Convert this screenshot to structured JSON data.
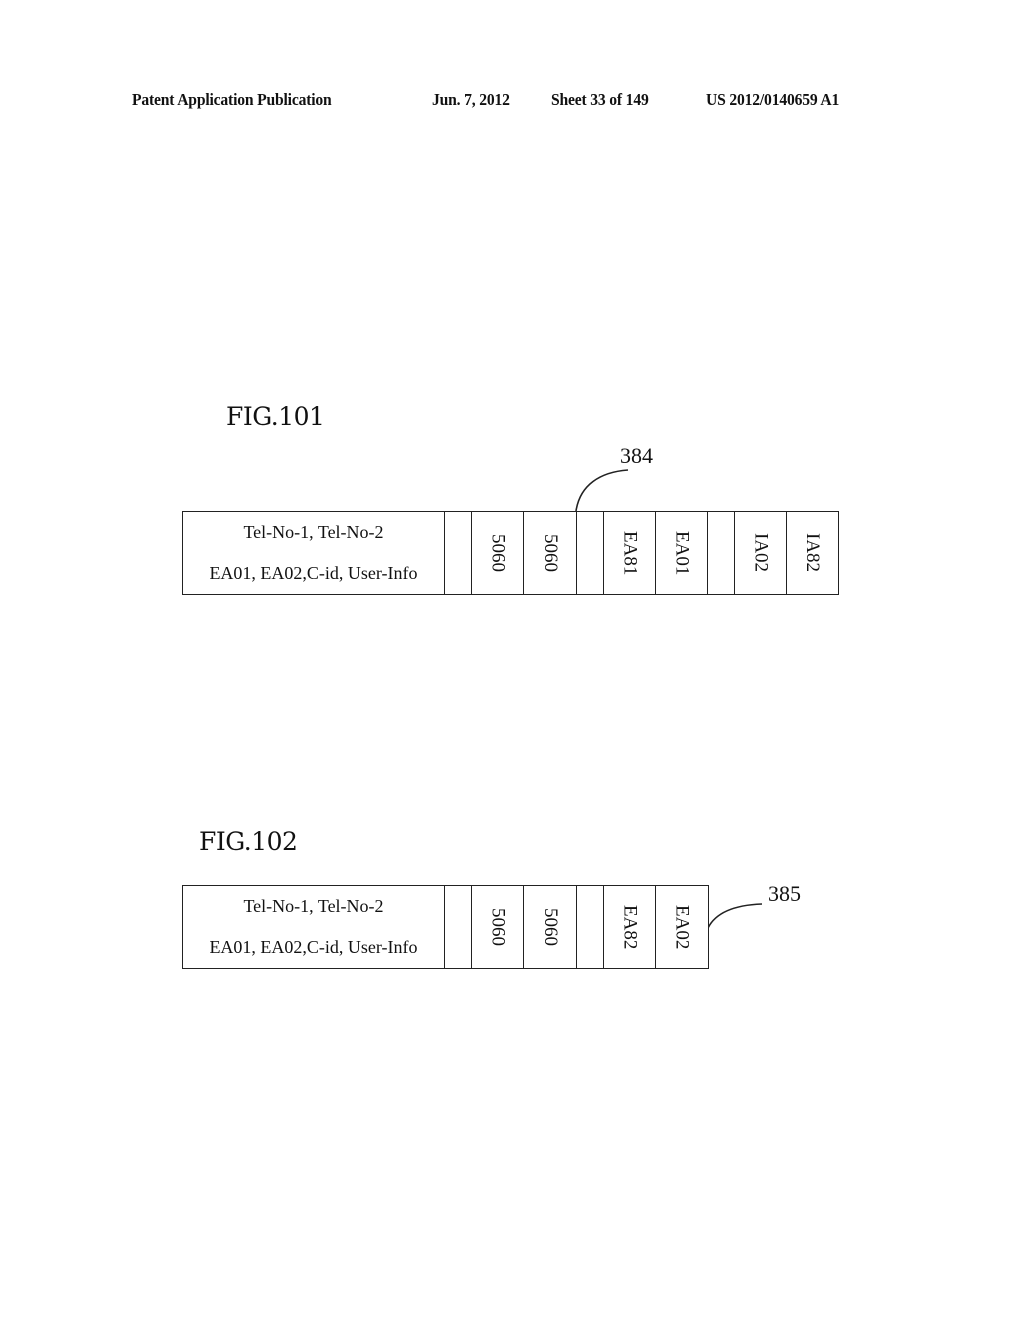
{
  "header": {
    "publication_type": "Patent Application Publication",
    "date": "Jun. 7, 2012",
    "sheet": "Sheet 33 of 149",
    "publication_number": "US 2012/0140659 A1"
  },
  "figures": [
    {
      "title": "FIG.101",
      "reference_label": "384",
      "info_lines": [
        "Tel-No-1, Tel-No-2",
        "EA01, EA02,C-id, User-Info"
      ],
      "fields": [
        "",
        "5060",
        "5060",
        "",
        "EA81",
        "EA01",
        "",
        "IA02",
        "IA82"
      ]
    },
    {
      "title": "FIG.102",
      "reference_label": "385",
      "info_lines": [
        "Tel-No-1, Tel-No-2",
        "EA01, EA02,C-id, User-Info"
      ],
      "fields": [
        "",
        "5060",
        "5060",
        "",
        "EA82",
        "EA02"
      ]
    }
  ]
}
